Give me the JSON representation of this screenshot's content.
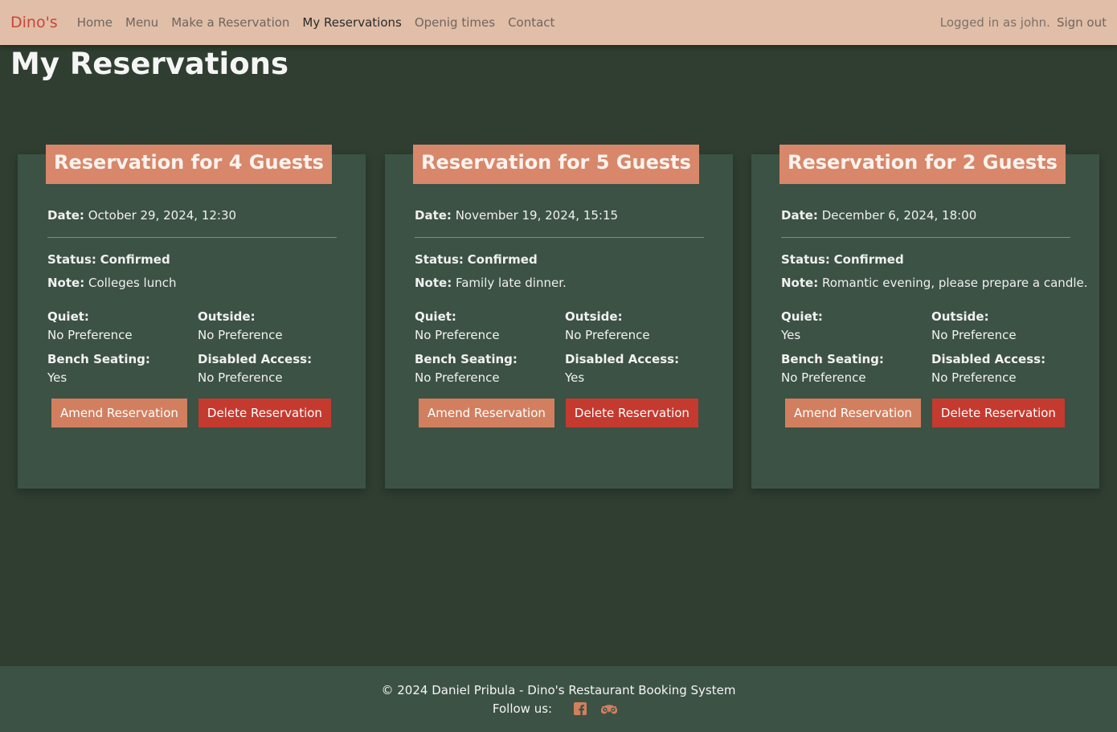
{
  "nav": {
    "brand": "Dino's",
    "links": [
      "Home",
      "Menu",
      "Make a Reservation",
      "My Reservations",
      "Openig times",
      "Contact"
    ],
    "user_text": "Logged in as john.",
    "signout": "Sign out"
  },
  "page": {
    "title": "My Reservations"
  },
  "labels": {
    "date": "Date:",
    "status": "Status:",
    "note": "Note:",
    "quiet": "Quiet:",
    "outside": "Outside:",
    "bench": "Bench Seating:",
    "disabled": "Disabled Access:",
    "amend": "Amend Reservation",
    "delete": "Delete Reservation"
  },
  "reservations": [
    {
      "title": "Reservation for 4 Guests",
      "date": "October 29, 2024, 12:30",
      "status": "Confirmed",
      "note": "Colleges lunch",
      "quiet": "No Preference",
      "outside": "No Preference",
      "bench": "Yes",
      "disabled": "No Preference"
    },
    {
      "title": "Reservation for 5 Guests",
      "date": "November 19, 2024, 15:15",
      "status": "Confirmed",
      "note": "Family late dinner.",
      "quiet": "No Preference",
      "outside": "No Preference",
      "bench": "No Preference",
      "disabled": "Yes"
    },
    {
      "title": "Reservation for 2 Guests",
      "date": "December 6, 2024, 18:00",
      "status": "Confirmed",
      "note": "Romantic evening, please prepare a candle.",
      "quiet": "Yes",
      "outside": "No Preference",
      "bench": "No Preference",
      "disabled": "No Preference"
    }
  ],
  "footer": {
    "copyright": "© 2024 Daniel Pribula - Dino's Restaurant Booking System",
    "follow": "Follow us:",
    "icons": [
      "facebook-icon",
      "tripadvisor-icon"
    ]
  },
  "colors": {
    "navbar": "#e1bea7",
    "brand": "#c9463a",
    "background": "#2f3e31",
    "card": "#3c5244",
    "accent": "#d8876a",
    "delete": "#c53a2f"
  }
}
